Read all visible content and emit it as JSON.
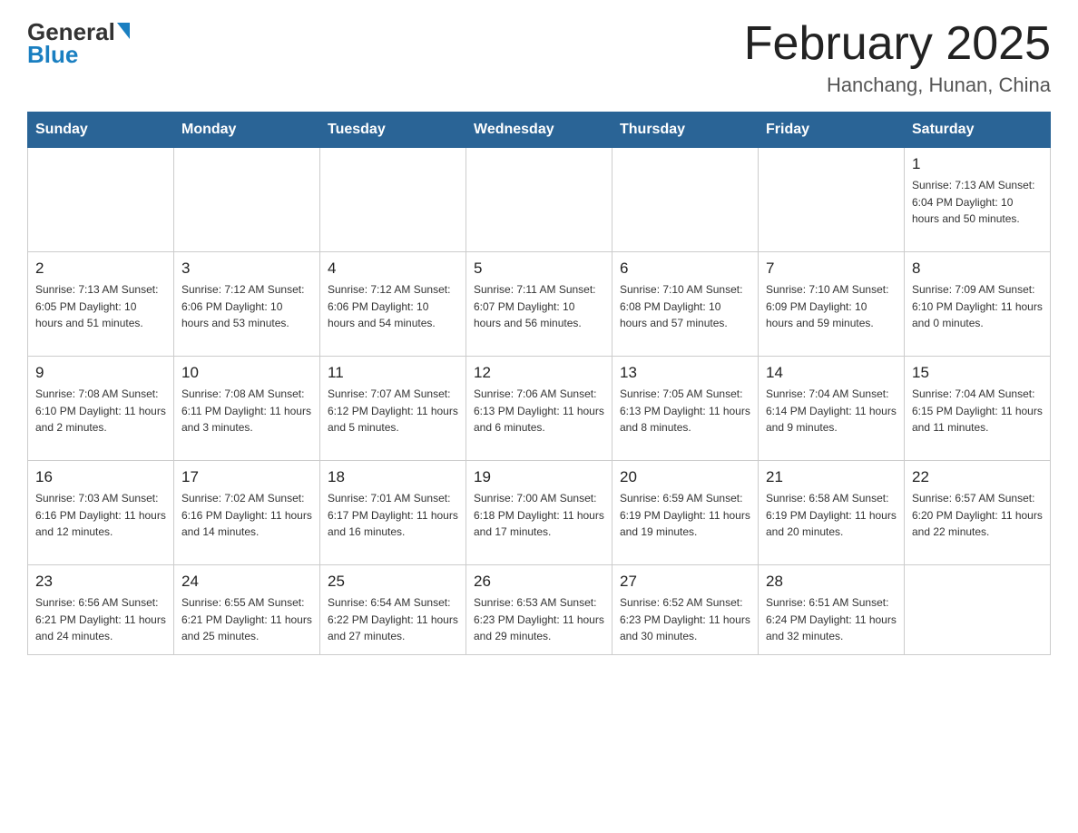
{
  "logo": {
    "general": "General",
    "triangle": "",
    "blue": "Blue"
  },
  "header": {
    "title": "February 2025",
    "subtitle": "Hanchang, Hunan, China"
  },
  "days_of_week": [
    "Sunday",
    "Monday",
    "Tuesday",
    "Wednesday",
    "Thursday",
    "Friday",
    "Saturday"
  ],
  "weeks": [
    {
      "days": [
        {
          "number": "",
          "info": ""
        },
        {
          "number": "",
          "info": ""
        },
        {
          "number": "",
          "info": ""
        },
        {
          "number": "",
          "info": ""
        },
        {
          "number": "",
          "info": ""
        },
        {
          "number": "",
          "info": ""
        },
        {
          "number": "1",
          "info": "Sunrise: 7:13 AM\nSunset: 6:04 PM\nDaylight: 10 hours\nand 50 minutes."
        }
      ]
    },
    {
      "days": [
        {
          "number": "2",
          "info": "Sunrise: 7:13 AM\nSunset: 6:05 PM\nDaylight: 10 hours\nand 51 minutes."
        },
        {
          "number": "3",
          "info": "Sunrise: 7:12 AM\nSunset: 6:06 PM\nDaylight: 10 hours\nand 53 minutes."
        },
        {
          "number": "4",
          "info": "Sunrise: 7:12 AM\nSunset: 6:06 PM\nDaylight: 10 hours\nand 54 minutes."
        },
        {
          "number": "5",
          "info": "Sunrise: 7:11 AM\nSunset: 6:07 PM\nDaylight: 10 hours\nand 56 minutes."
        },
        {
          "number": "6",
          "info": "Sunrise: 7:10 AM\nSunset: 6:08 PM\nDaylight: 10 hours\nand 57 minutes."
        },
        {
          "number": "7",
          "info": "Sunrise: 7:10 AM\nSunset: 6:09 PM\nDaylight: 10 hours\nand 59 minutes."
        },
        {
          "number": "8",
          "info": "Sunrise: 7:09 AM\nSunset: 6:10 PM\nDaylight: 11 hours\nand 0 minutes."
        }
      ]
    },
    {
      "days": [
        {
          "number": "9",
          "info": "Sunrise: 7:08 AM\nSunset: 6:10 PM\nDaylight: 11 hours\nand 2 minutes."
        },
        {
          "number": "10",
          "info": "Sunrise: 7:08 AM\nSunset: 6:11 PM\nDaylight: 11 hours\nand 3 minutes."
        },
        {
          "number": "11",
          "info": "Sunrise: 7:07 AM\nSunset: 6:12 PM\nDaylight: 11 hours\nand 5 minutes."
        },
        {
          "number": "12",
          "info": "Sunrise: 7:06 AM\nSunset: 6:13 PM\nDaylight: 11 hours\nand 6 minutes."
        },
        {
          "number": "13",
          "info": "Sunrise: 7:05 AM\nSunset: 6:13 PM\nDaylight: 11 hours\nand 8 minutes."
        },
        {
          "number": "14",
          "info": "Sunrise: 7:04 AM\nSunset: 6:14 PM\nDaylight: 11 hours\nand 9 minutes."
        },
        {
          "number": "15",
          "info": "Sunrise: 7:04 AM\nSunset: 6:15 PM\nDaylight: 11 hours\nand 11 minutes."
        }
      ]
    },
    {
      "days": [
        {
          "number": "16",
          "info": "Sunrise: 7:03 AM\nSunset: 6:16 PM\nDaylight: 11 hours\nand 12 minutes."
        },
        {
          "number": "17",
          "info": "Sunrise: 7:02 AM\nSunset: 6:16 PM\nDaylight: 11 hours\nand 14 minutes."
        },
        {
          "number": "18",
          "info": "Sunrise: 7:01 AM\nSunset: 6:17 PM\nDaylight: 11 hours\nand 16 minutes."
        },
        {
          "number": "19",
          "info": "Sunrise: 7:00 AM\nSunset: 6:18 PM\nDaylight: 11 hours\nand 17 minutes."
        },
        {
          "number": "20",
          "info": "Sunrise: 6:59 AM\nSunset: 6:19 PM\nDaylight: 11 hours\nand 19 minutes."
        },
        {
          "number": "21",
          "info": "Sunrise: 6:58 AM\nSunset: 6:19 PM\nDaylight: 11 hours\nand 20 minutes."
        },
        {
          "number": "22",
          "info": "Sunrise: 6:57 AM\nSunset: 6:20 PM\nDaylight: 11 hours\nand 22 minutes."
        }
      ]
    },
    {
      "days": [
        {
          "number": "23",
          "info": "Sunrise: 6:56 AM\nSunset: 6:21 PM\nDaylight: 11 hours\nand 24 minutes."
        },
        {
          "number": "24",
          "info": "Sunrise: 6:55 AM\nSunset: 6:21 PM\nDaylight: 11 hours\nand 25 minutes."
        },
        {
          "number": "25",
          "info": "Sunrise: 6:54 AM\nSunset: 6:22 PM\nDaylight: 11 hours\nand 27 minutes."
        },
        {
          "number": "26",
          "info": "Sunrise: 6:53 AM\nSunset: 6:23 PM\nDaylight: 11 hours\nand 29 minutes."
        },
        {
          "number": "27",
          "info": "Sunrise: 6:52 AM\nSunset: 6:23 PM\nDaylight: 11 hours\nand 30 minutes."
        },
        {
          "number": "28",
          "info": "Sunrise: 6:51 AM\nSunset: 6:24 PM\nDaylight: 11 hours\nand 32 minutes."
        },
        {
          "number": "",
          "info": ""
        }
      ]
    }
  ]
}
